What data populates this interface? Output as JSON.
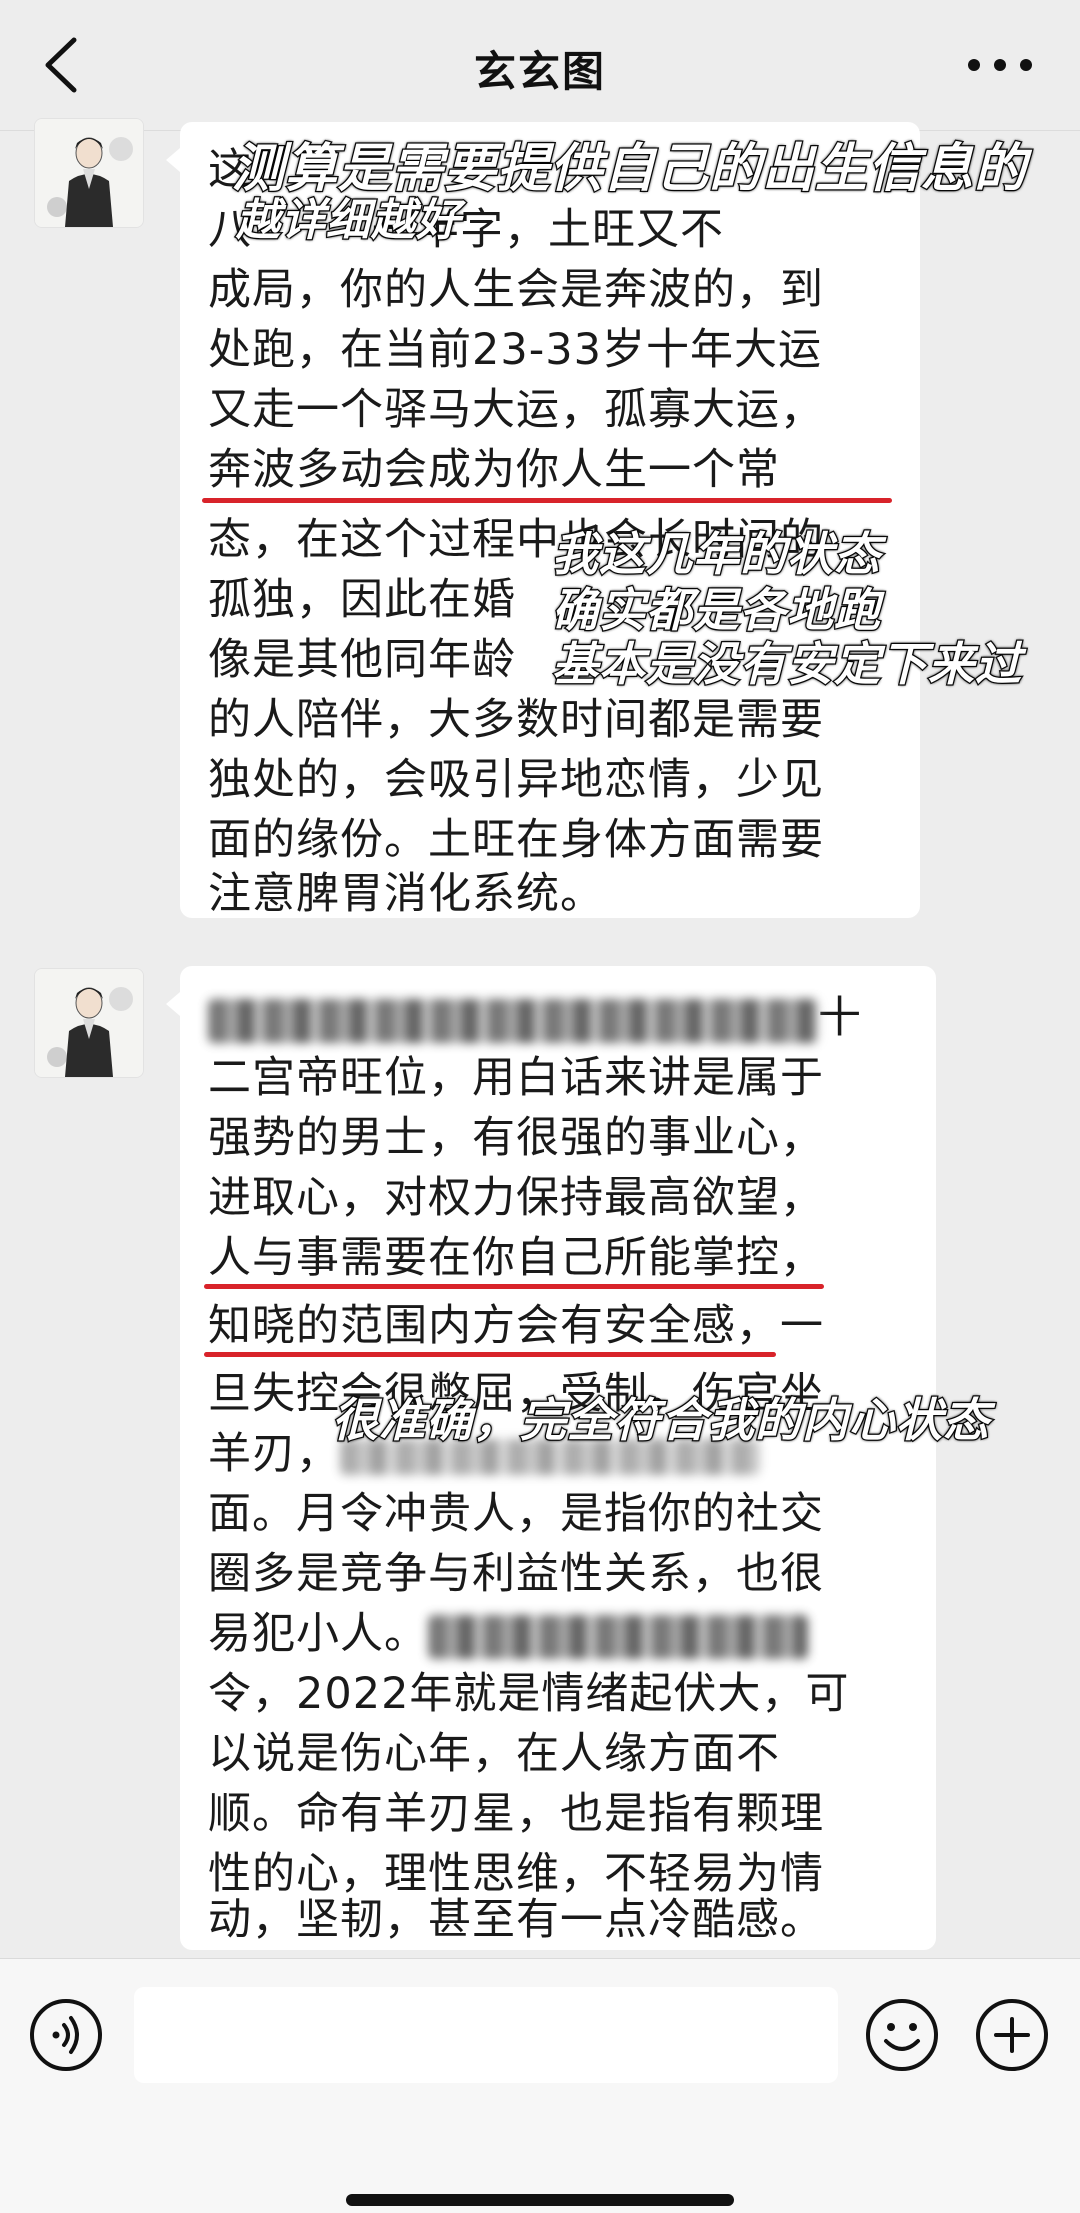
{
  "header": {
    "title": "玄玄图",
    "back_icon": "chevron-left-icon",
    "more_icon": "ellipsis-icon"
  },
  "messages": [
    {
      "lines": [
        "这",
        "八",
        "成局，你的人生会是奔波的，到",
        "处跑，在当前23-33岁十年大运",
        "又走一个驿马大运，孤寡大运，",
        "奔波多动会成为你人生一个常",
        "态，在这个过程中也会长时间的",
        "孤独，因此在婚",
        "像是其他同年龄",
        "的人陪伴，大多数时间都是需要",
        "独处的，会吸引异地恋情，少见",
        "面的缘份。土旺在身体方面需要",
        "注意脾胃消化系统。"
      ],
      "line2_suffix": "一半字，土旺又不"
    },
    {
      "lines": [
        "十",
        "二宫帝旺位，用白话来讲是属于",
        "强势的男士，有很强的事业心，",
        "进取心，对权力保持最高欲望，",
        "人与事需要在你自己所能掌控，",
        "知晓的范围内方会有安全感，一",
        "旦失控会很憋屈，受制。伤官坐",
        "羊刃，",
        "面。月令冲贵人，是指你的社交",
        "圈多是竞争与利益性关系，也很",
        "易犯小人。",
        "令，2022年就是情绪起伏大，可",
        "以说是伤心年，在人缘方面不",
        "顺。命有羊刃星，也是指有颗理",
        "性的心，理性思维，不轻易为情",
        "动，坚韧，甚至有一点冷酷感。"
      ],
      "line8_suffix": "面"
    }
  ],
  "captions": {
    "top_1": "测算是需要提供自己的出生信息的",
    "top_2": "越详细越好",
    "mid_1": "我这几年的状态",
    "mid_2": "确实都是各地跑",
    "mid_3": "基本是没有安定下来过",
    "bottom": "很准确，完全符合我的内心状态"
  },
  "input_bar": {
    "placeholder": "",
    "voice_icon": "voice-icon",
    "emoji_icon": "emoji-icon",
    "plus_icon": "plus-icon"
  },
  "colors": {
    "background": "#ededed",
    "bubble": "#ffffff",
    "underline": "#d8232a"
  }
}
